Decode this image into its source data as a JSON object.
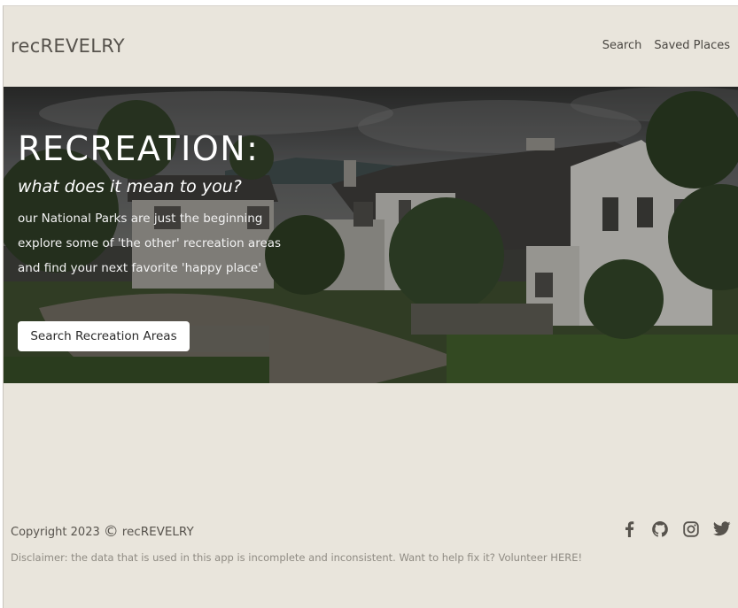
{
  "navbar": {
    "brand": "recREVELRY",
    "links": [
      {
        "label": "Search"
      },
      {
        "label": "Saved Places"
      }
    ]
  },
  "hero": {
    "title": "RECREATION:",
    "subtitle": "what does it mean to you?",
    "lines": [
      "our National Parks are just the beginning",
      "explore some of 'the other' recreation areas",
      "and find your next favorite 'happy place'"
    ],
    "cta_label": "Search Recreation Areas"
  },
  "footer": {
    "copyright_text": "Copyright 2023",
    "copyright_symbol": "©",
    "brand": "recREVELRY",
    "social": [
      "facebook-icon",
      "github-icon",
      "instagram-icon",
      "twitter-icon"
    ],
    "disclaimer": "Disclaimer: the data that is used in this app is incomplete and inconsistent. Want to help fix it? Volunteer HERE!"
  },
  "colors": {
    "background": "#e9e5dc",
    "brand_text": "#57534d",
    "hero_overlay": "#3d3f3a",
    "button_bg": "#ffffff",
    "disclaimer_text": "#8f8b83"
  }
}
